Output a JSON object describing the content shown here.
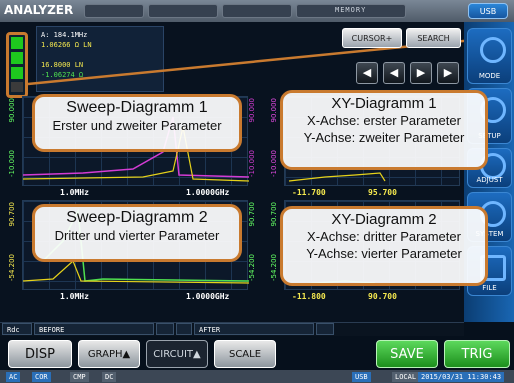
{
  "topbar": {
    "title": "ANALYZER",
    "memory": "MEMORY",
    "usb": "USB"
  },
  "readout": {
    "line1": "A: 184.1MHz",
    "line2": "1.06266 Ω LN",
    "line3": "",
    "line4": "16.8000 LN",
    "line5": "-1.06274 Ω"
  },
  "cursor": {
    "cursor_label": "CURSOR+",
    "search_label": "SEARCH",
    "left2": "◀",
    "left1": "◀",
    "right1": "▶",
    "right2": "▶"
  },
  "side": {
    "mode": "MODE",
    "setup": "SETUP",
    "adjust": "ADJUST",
    "system": "SYSTEM",
    "file": "FILE"
  },
  "graphs": {
    "sweep1": {
      "x_start": "1.0MHz",
      "x_end": "1.0000GHz",
      "y_top": "90.000",
      "y_bottom": "-10.000",
      "y_left": "90.000",
      "y_left2": "-10.000"
    },
    "xy1": {
      "x_start": "-11.700",
      "x_end": "95.700",
      "y_top": "90.000",
      "y_bottom": "-10.000"
    },
    "sweep2": {
      "x_start": "1.0MHz",
      "x_end": "1.0000GHz",
      "y_top": "90.700",
      "y_bottom": "-54.200",
      "y_left": "90.700",
      "y_left2": "-54.200"
    },
    "xy2": {
      "x_start": "-11.800",
      "x_end": "90.700",
      "y_top": "90.700",
      "y_bottom": "-54.200"
    }
  },
  "annotations": {
    "a1_title": "Sweep-Diagramm 1",
    "a1_sub": "Erster und zweiter Parameter",
    "a2_title": "XY-Diagramm 1",
    "a2_sub1": "X-Achse: erster Parameter",
    "a2_sub2": "Y-Achse: zweiter Parameter",
    "a3_title": "Sweep-Diagramm 2",
    "a3_sub": "Dritter und vierter Parameter",
    "a4_title": "XY-Diagramm 2",
    "a4_sub1": "X-Achse: dritter Parameter",
    "a4_sub2": "Y-Achse: vierter Parameter"
  },
  "status": {
    "rdc": "Rdc",
    "before": "BEFORE",
    "after": "AFTER"
  },
  "buttons": {
    "disp": "DISP",
    "graph": "GRAPH▲",
    "circuit": "CIRCUIT▲",
    "scale": "SCALE",
    "save": "SAVE",
    "trig": "TRIG"
  },
  "bottombar": {
    "ac": "AC",
    "cor": "COR",
    "cmp": "CMP",
    "dc": "DC",
    "usb": "USB",
    "local": "LOCAL",
    "datetime": "2015/03/31 11:30:43"
  },
  "colors": {
    "accent_orange": "#c97a2f",
    "trace_yellow": "#e6d21a",
    "trace_magenta": "#d43cd4",
    "trace_green": "#4fe04f"
  }
}
